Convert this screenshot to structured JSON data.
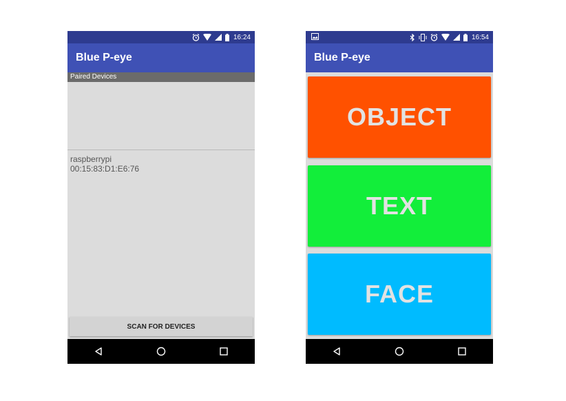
{
  "left_screen": {
    "status_time": "16:24",
    "app_title": "Blue P-eye",
    "section_header": "Paired Devices",
    "devices": [
      {
        "name": "raspberrypi",
        "address": "00:15:83:D1:E6:76"
      }
    ],
    "scan_button_label": "SCAN FOR DEVICES"
  },
  "right_screen": {
    "status_time": "16:54",
    "app_title": "Blue P-eye",
    "buttons": [
      {
        "label": "OBJECT",
        "color": "#ff5100"
      },
      {
        "label": "TEXT",
        "color": "#12ee3a"
      },
      {
        "label": "FACE",
        "color": "#00bbff"
      }
    ]
  },
  "colors": {
    "status_bar": "#2e3b8f",
    "app_bar": "#3f51b5",
    "screen_background": "#dcdcdc",
    "nav_bar": "#000000"
  }
}
